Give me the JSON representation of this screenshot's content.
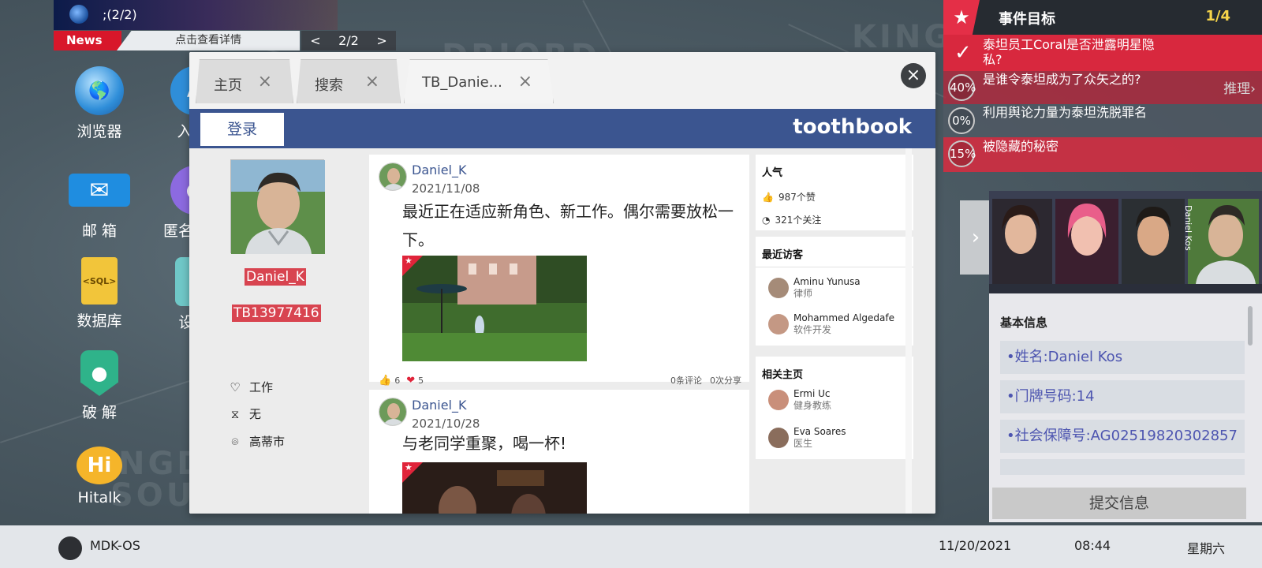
{
  "topbar": {
    "counter": ";(2/2)"
  },
  "news": {
    "tag": "News",
    "hint": "点击查看详情",
    "prev": "<",
    "page": "2/2",
    "next": ">"
  },
  "desktop": [
    {
      "label": "浏览器",
      "icon": "globe-icon"
    },
    {
      "label": "邮 箱",
      "icon": "mail-icon"
    },
    {
      "label": "数据库",
      "icon": "sql-file-icon",
      "glyph": "<SQL>"
    },
    {
      "label": "破 解",
      "icon": "shield-key-icon"
    },
    {
      "label": "Hitalk",
      "icon": "hitalk-icon",
      "glyph": "Hi"
    },
    {
      "label": "入",
      "icon": "app-icon"
    },
    {
      "label": "匿名",
      "icon": "chat-icon"
    },
    {
      "label": "设",
      "icon": "settings-icon"
    }
  ],
  "browser": {
    "tabs": [
      {
        "label": "主页"
      },
      {
        "label": "搜索"
      },
      {
        "label": "TB_Danie..."
      }
    ],
    "close": "×",
    "login": "登录",
    "brand": "toothbook"
  },
  "profile": {
    "name": "Daniel_K",
    "id": "TB13977416",
    "job": "工作",
    "relationship": "无",
    "city": "高蒂市"
  },
  "posts": [
    {
      "author": "Daniel_K",
      "date": "2021/11/08",
      "text": "最近正在适应新角色、新工作。偶尔需要放松一下。",
      "likes": "6",
      "hearts": "5",
      "comments": "0条评论",
      "shares": "0次分享"
    },
    {
      "author": "Daniel_K",
      "date": "2021/10/28",
      "text": "与老同学重聚，喝一杯!"
    }
  ],
  "sidebar": {
    "popularity": {
      "title": "人气",
      "likes": "987个赞",
      "follows": "321个关注"
    },
    "visitors": {
      "title": "最近访客",
      "people": [
        {
          "name": "Aminu Yunusa",
          "role": "律师"
        },
        {
          "name": "Mohammed Algedafe",
          "role": "软件开发"
        }
      ]
    },
    "related": {
      "title": "相关主页",
      "people": [
        {
          "name": "Ermi Uc",
          "role": "健身教练"
        },
        {
          "name": "Eva Soares",
          "role": "医生"
        }
      ]
    }
  },
  "objectives": {
    "title": "事件目标",
    "progress": "1/4",
    "infer": "推理›",
    "items": [
      {
        "text": "泰坦员工Coral是否泄露明星隐私?",
        "status": "done"
      },
      {
        "text": "是谁令泰坦成为了众矢之的?",
        "pct": "40%"
      },
      {
        "text": "利用舆论力量为泰坦洗脱罪名",
        "pct": "0%"
      },
      {
        "text": "被隐藏的秘密",
        "pct": "15%"
      }
    ]
  },
  "character": {
    "strip_names": [
      "Daniel Kos"
    ],
    "section": "基本信息",
    "fields": [
      "•姓名:Daniel Kos",
      "•门牌号码:14",
      "•社会保障号:AG02519820302857"
    ],
    "submit": "提交信息"
  },
  "taskbar": {
    "os": "MDK-OS",
    "date": "11/20/2021",
    "time": "08:44",
    "day": "星期六"
  },
  "colors": {
    "accent": "#3b5590",
    "alert": "#e42f47",
    "label_red": "#d84450"
  }
}
